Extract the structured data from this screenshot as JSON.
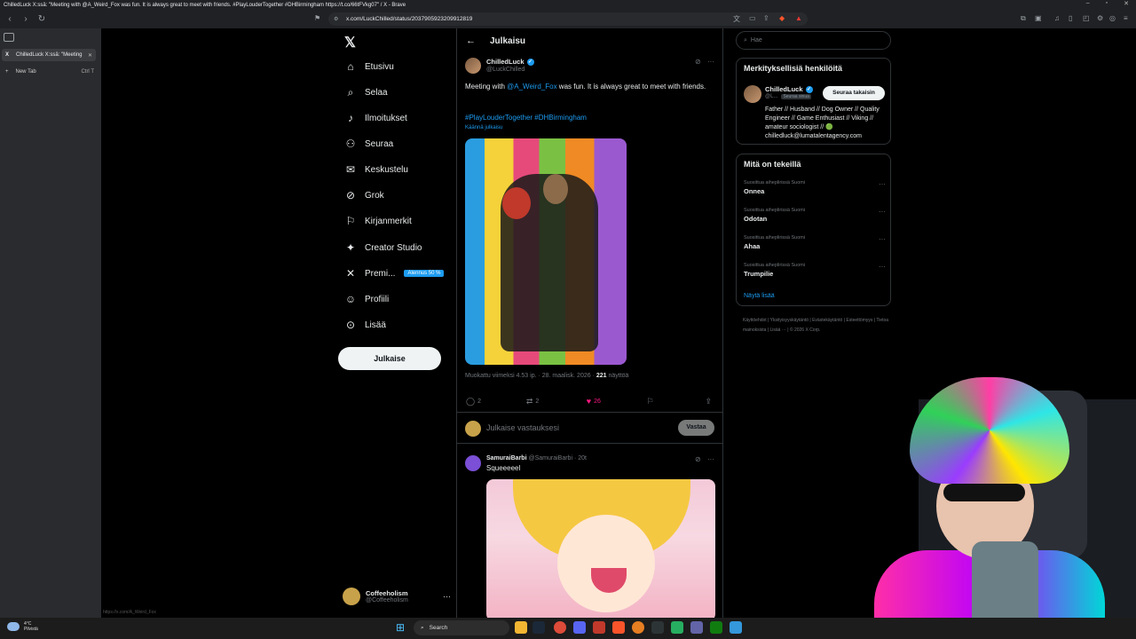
{
  "browser": {
    "window_title": "ChilledLuck X:ssä: \"Meeting with @A_Weird_Fox was fun. It is always great to meet with friends. #PlayLouderTogether #DHBirmingham https://t.co/66tFVkg07\" / X - Brave",
    "url": "x.com/LuckChilled/status/2037905923209912819",
    "tab_title": "ChilledLuck X:ssä: \"Meeting",
    "new_tab_label": "New Tab",
    "new_tab_shortcut": "Ctrl  T",
    "status_link": "https://x.com/A_Weird_Fox"
  },
  "nav": {
    "items": [
      {
        "label": "Etusivu",
        "icon": "home-icon"
      },
      {
        "label": "Selaa",
        "icon": "search-icon"
      },
      {
        "label": "Ilmoitukset",
        "icon": "bell-icon"
      },
      {
        "label": "Seuraa",
        "icon": "follow-icon"
      },
      {
        "label": "Keskustelu",
        "icon": "mail-icon"
      },
      {
        "label": "Grok",
        "icon": "grok-icon"
      },
      {
        "label": "Kirjanmerkit",
        "icon": "bookmark-icon"
      },
      {
        "label": "Creator Studio",
        "icon": "creator-icon"
      },
      {
        "label": "Premi...",
        "icon": "x-icon",
        "badge": "Alennus 50 %"
      },
      {
        "label": "Profiili",
        "icon": "profile-icon"
      },
      {
        "label": "Lisää",
        "icon": "more-icon"
      }
    ],
    "post_button": "Julkaise",
    "account": {
      "name": "Coffeeholism",
      "handle": "@Coffeeholism",
      "more": "···"
    }
  },
  "main": {
    "header_title": "Julkaisu",
    "tweet": {
      "name": "ChilledLuck",
      "handle": "@LuckChilled",
      "text_before": "Meeting with ",
      "mention": "@A_Weird_Fox",
      "text_after": " was fun. It is always great to meet with friends.",
      "hashtags": "#PlayLouderTogether #DHBirmingham",
      "translate": "Käännä julkaisu",
      "meta_prefix": "Muokattu viimeksi 4.53 ip. · 28. maalisk. 2026 · ",
      "views_count": "221",
      "views_label": " näyttöä",
      "replies": "2",
      "reposts": "2",
      "likes": "26"
    },
    "reply_placeholder": "Julkaise vastauksesi",
    "reply_button": "Vastaa",
    "reply": {
      "name": "SamuraiBarbi",
      "handle": "@SamuraiBarbi · 20t",
      "text": "Squeeeeel"
    }
  },
  "sidebar": {
    "search_placeholder": "Hae",
    "who": {
      "title": "Merkityksellisiä henkilöitä",
      "name": "ChilledLuck",
      "handle": "@L...",
      "follows_you": "Seuraa sinua",
      "button": "Seuraa takaisin",
      "bio": "Father // Husband // Dog Owner // Quality Engineer // Game Enthusiast // Viking // amateur sociologist // 🟢 chilledluck@lumatalentagency.com"
    },
    "trends": {
      "title": "Mitä on tekeillä",
      "items": [
        {
          "context": "Suosittua aiheplirissä Suomi",
          "name": "Onnea"
        },
        {
          "context": "Suosittua aiheplirissä Suomi",
          "name": "Odotan"
        },
        {
          "context": "Suosittua aiheplirissä Suomi",
          "name": "Ahaa"
        },
        {
          "context": "Suosittua aiheplirissä Suomi",
          "name": "Trumpilie"
        }
      ],
      "show_more": "Näytä lisää"
    },
    "footer": "Käyttöehdot  |  Yksityisyyskäytäntö  |  Evästekäytäntö  |  Esteettömyys  |  Tietoa mainoksista  |  Lisää ···  |  © 2026 X Corp."
  },
  "taskbar": {
    "weather_temp": "4°C",
    "weather_text": "Pilvistä",
    "search_label": "Search"
  }
}
